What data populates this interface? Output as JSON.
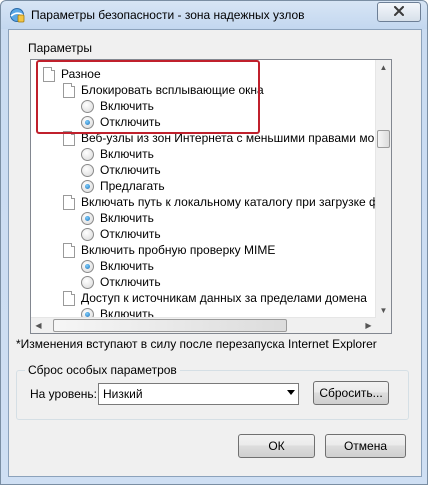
{
  "window": {
    "title": "Параметры безопасности - зона надежных узлов"
  },
  "settings_group": {
    "label": "Параметры"
  },
  "tree": {
    "rows": [
      {
        "type": "category",
        "label": "Разное",
        "indent": 1
      },
      {
        "type": "setting",
        "label": "Блокировать всплывающие окна",
        "indent": 2
      },
      {
        "type": "option",
        "label": "Включить",
        "checked": false
      },
      {
        "type": "option",
        "label": "Отключить",
        "checked": true
      },
      {
        "type": "setting",
        "label": "Веб-узлы из зон Интернета с меньшими правами могут от",
        "indent": 2
      },
      {
        "type": "option",
        "label": "Включить",
        "checked": false
      },
      {
        "type": "option",
        "label": "Отключить",
        "checked": false
      },
      {
        "type": "option",
        "label": "Предлагать",
        "checked": true
      },
      {
        "type": "setting",
        "label": "Включать путь к локальному каталогу при загрузке фай",
        "indent": 2
      },
      {
        "type": "option",
        "label": "Включить",
        "checked": true
      },
      {
        "type": "option",
        "label": "Отключить",
        "checked": false
      },
      {
        "type": "setting",
        "label": "Включить пробную проверку MIME",
        "indent": 2
      },
      {
        "type": "option",
        "label": "Включить",
        "checked": true
      },
      {
        "type": "option",
        "label": "Отключить",
        "checked": false
      },
      {
        "type": "setting",
        "label": "Доступ к источникам данных за пределами домена",
        "indent": 2
      },
      {
        "type": "option",
        "label": "Включить",
        "checked": true
      }
    ]
  },
  "note": "*Изменения вступают в силу после перезапуска Internet Explorer",
  "reset": {
    "group_label": "Сброс особых параметров",
    "level_label": "На уровень:",
    "level_value": "Низкий",
    "reset_button": "Сбросить..."
  },
  "buttons": {
    "ok": "ОК",
    "cancel": "Отмена"
  },
  "colors": {
    "highlight": "#c0202c",
    "radio_selected": "#1f6fb5"
  },
  "icons": {
    "title": "ie-security-icon",
    "close": "close-icon"
  }
}
